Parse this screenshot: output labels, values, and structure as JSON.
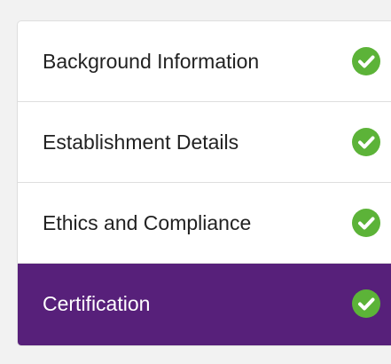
{
  "steps": [
    {
      "label": "Background Information",
      "status_icon": "check-circle-icon",
      "active": false
    },
    {
      "label": "Establishment Details",
      "status_icon": "check-circle-icon",
      "active": false
    },
    {
      "label": "Ethics and Compliance",
      "status_icon": "check-circle-icon",
      "active": false
    },
    {
      "label": "Certification",
      "status_icon": "check-circle-icon",
      "active": true
    }
  ],
  "colors": {
    "active_background": "#57207a",
    "check_green": "#5cb338",
    "text": "#222222"
  }
}
